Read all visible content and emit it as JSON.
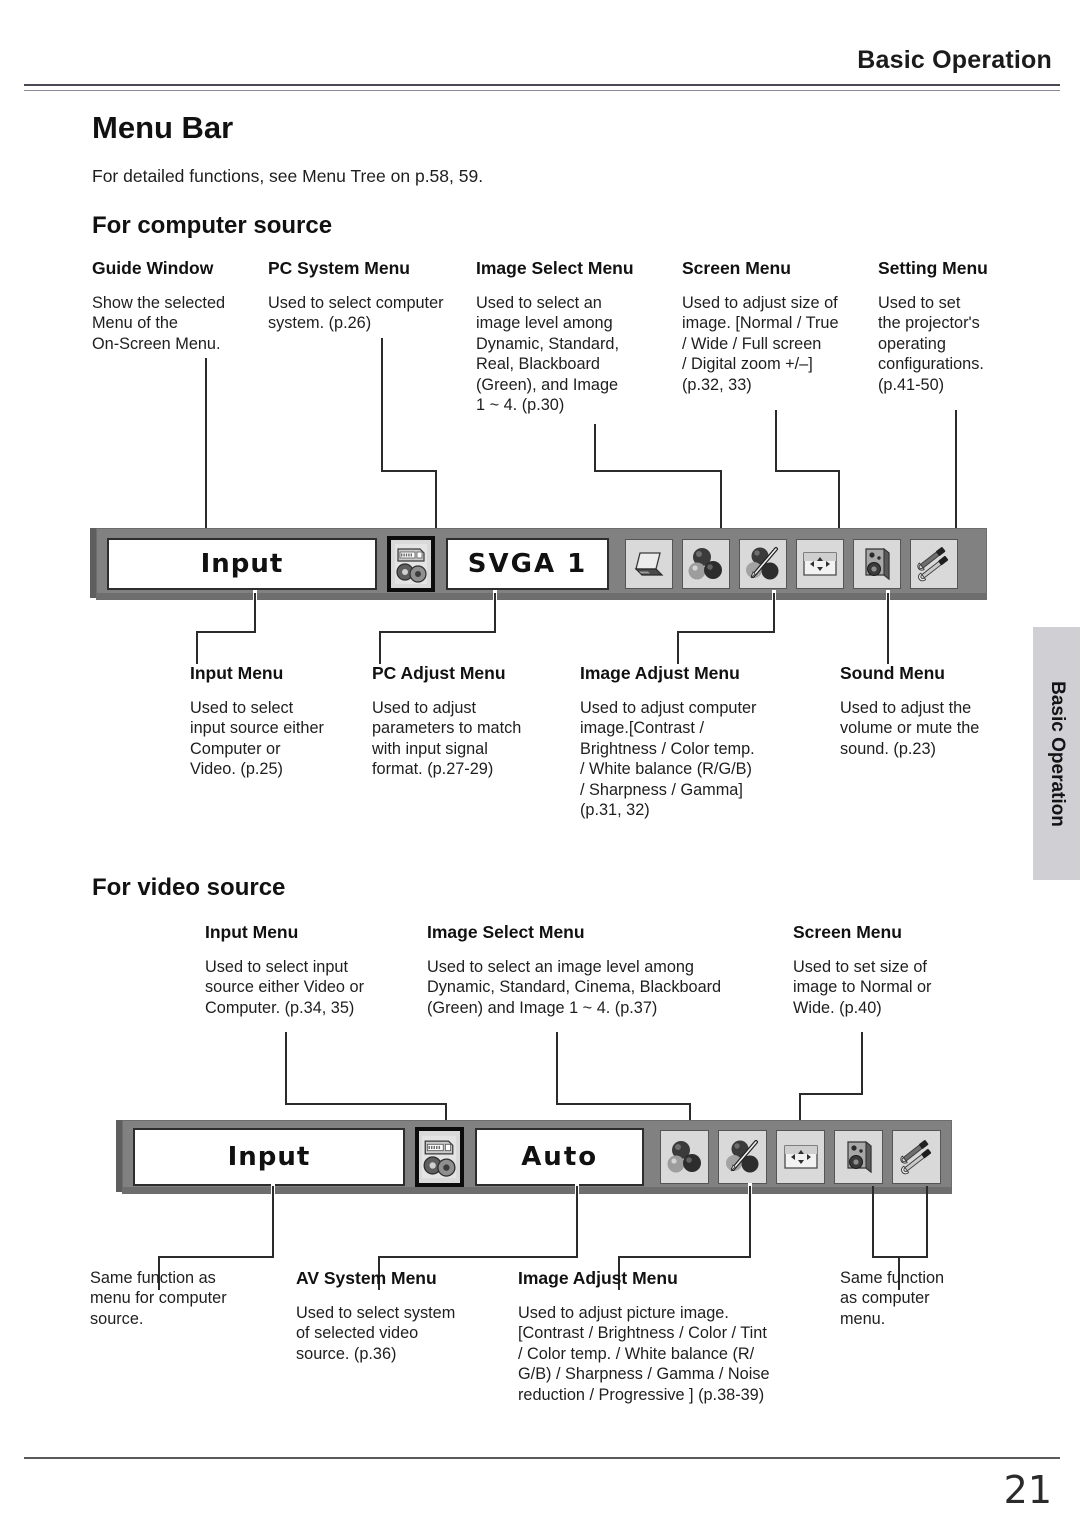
{
  "header": {
    "chapter": "Basic Operation"
  },
  "page": {
    "title": "Menu Bar",
    "intro": "For detailed functions, see Menu Tree on p.58, 59.",
    "number": "21"
  },
  "sections": {
    "computer": {
      "heading": "For computer source"
    },
    "video": {
      "heading": "For video source"
    }
  },
  "computer_top": [
    {
      "title": "Guide Window",
      "body": "Show the selected\nMenu of the\nOn-Screen Menu."
    },
    {
      "title": "PC System Menu",
      "body": "Used to select computer\nsystem. (p.26)"
    },
    {
      "title": "Image Select Menu",
      "body": "Used to select an\nimage level among\nDynamic, Standard,\nReal, Blackboard\n(Green), and Image\n1 ~ 4. (p.30)"
    },
    {
      "title": "Screen Menu",
      "body": "Used to adjust size of\nimage. [Normal / True\n/ Wide / Full screen\n/ Digital zoom +/–]\n(p.32, 33)"
    },
    {
      "title": "Setting Menu",
      "body": "Used to set\nthe projector's\noperating\nconfigurations.\n(p.41-50)"
    }
  ],
  "computer_bottom": [
    {
      "title": "Input Menu",
      "body": "Used to select\ninput source either\nComputer or\nVideo. (p.25)"
    },
    {
      "title": "PC Adjust Menu",
      "body": "Used to adjust\nparameters to match\nwith input signal\nformat. (p.27-29)"
    },
    {
      "title": "Image Adjust Menu",
      "body": "Used to adjust computer\nimage.[Contrast /\nBrightness / Color temp.\n/ White balance (R/G/B)\n/ Sharpness / Gamma]\n(p.31, 32)"
    },
    {
      "title": "Sound Menu",
      "body": "Used to adjust the\nvolume or mute the\nsound. (p.23)"
    }
  ],
  "video_top": [
    {
      "title": "Input Menu",
      "body": "Used to select input\nsource either Video or\nComputer. (p.34, 35)"
    },
    {
      "title": "Image Select Menu",
      "body": "Used to select an image level among\nDynamic, Standard, Cinema, Blackboard\n(Green) and Image 1 ~ 4. (p.37)"
    },
    {
      "title": "Screen Menu",
      "body": "Used to set size of\nimage to Normal or\nWide. (p.40)"
    }
  ],
  "video_bottom": [
    {
      "title": "",
      "body": "Same function as\nmenu for computer\nsource."
    },
    {
      "title": "AV System Menu",
      "body": "Used to select system\nof selected video\nsource. (p.36)"
    },
    {
      "title": "Image Adjust Menu",
      "body": "Used to adjust picture image.\n[Contrast / Brightness / Color / Tint\n/ Color temp. / White balance (R/\nG/B) / Sharpness / Gamma / Noise\nreduction / Progressive ] (p.38-39)"
    },
    {
      "title": "",
      "body": "Same function\nas computer\nmenu."
    }
  ],
  "menubar_computer": {
    "guide_label": "Input",
    "system_label": "SVGA 1",
    "icons": [
      "pc-system-icon",
      "pc-adjust-icon",
      "image-select-icon",
      "image-adjust-icon",
      "screen-icon",
      "sound-icon",
      "setting-icon"
    ]
  },
  "menubar_video": {
    "guide_label": "Input",
    "system_label": "Auto",
    "icons": [
      "av-system-icon",
      "image-select-icon",
      "image-adjust-icon",
      "screen-icon",
      "sound-icon",
      "setting-icon"
    ]
  },
  "sidetab": {
    "label": "Basic Operation"
  },
  "colors": {
    "bar": "#818181",
    "bar_shadow": "#6e6e6e",
    "icon_face": "#d9d9d9",
    "selected_border": "#0c0c0c",
    "sidetab": "#cfcfd4"
  }
}
